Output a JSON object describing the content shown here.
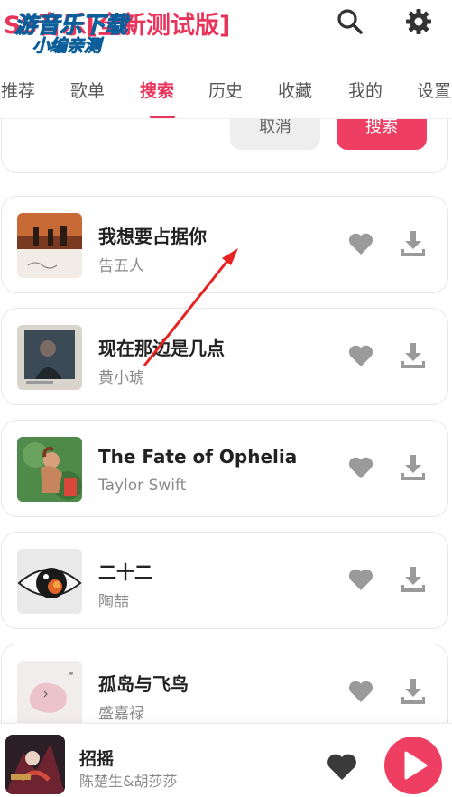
{
  "header": {
    "title": "SS音乐[全新测试版]",
    "watermark_top": "游音乐下载",
    "watermark_bottom": "小编亲测",
    "search_icon": "search-icon",
    "settings_icon": "gear-icon"
  },
  "tabs": [
    {
      "label": "推荐",
      "active": false
    },
    {
      "label": "歌单",
      "active": false
    },
    {
      "label": "搜索",
      "active": true
    },
    {
      "label": "历史",
      "active": false
    },
    {
      "label": "收藏",
      "active": false
    },
    {
      "label": "我的",
      "active": false
    },
    {
      "label": "设置",
      "active": false
    }
  ],
  "search_panel": {
    "cancel_label": "取消",
    "search_label": "搜索"
  },
  "results": [
    {
      "title": "我想要占据你",
      "artist": "告五人"
    },
    {
      "title": "现在那边是几点",
      "artist": "黄小琥"
    },
    {
      "title": "The Fate of Ophelia",
      "artist": "Taylor Swift"
    },
    {
      "title": "二十二",
      "artist": "陶喆"
    },
    {
      "title": "孤岛与飞鸟",
      "artist": "盛嘉禄"
    }
  ],
  "player": {
    "title": "招摇",
    "artist": "陈楚生&胡莎莎"
  },
  "colors": {
    "accent": "#ee3f63",
    "icon_gray": "#9a9a9a",
    "tab_text": "#555555"
  }
}
